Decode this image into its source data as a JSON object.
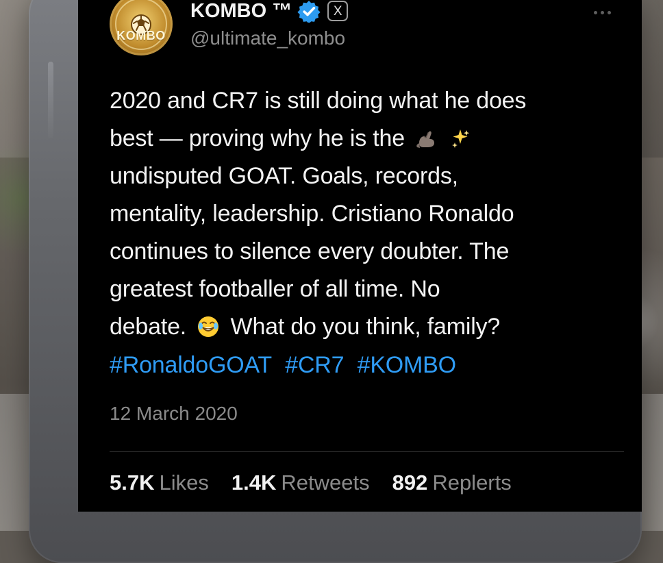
{
  "profile": {
    "display_name": "KOMBO ™",
    "handle": "@ultimate_kombo",
    "avatar_text": "KOMBO"
  },
  "icons": {
    "verified": "verified-badge-icon",
    "platform": "x-logo-icon",
    "more": "more-options-icon",
    "flex": "flexed-biceps-icon",
    "sparkles": "sparkles-icon",
    "laugh": "laughing-face-icon"
  },
  "platform_badge_label": "X",
  "tweet": {
    "lines": [
      "2020 and CR7 is still doing what he does",
      "best — proving why he is the",
      "undisputed GOAT. Goals, records,",
      "mentality, leadership. Cristiano Ronaldo",
      "continues to silence every doubter. The",
      "greatest footballer of all time. No",
      "debate.",
      "What do you think, family?"
    ],
    "hashtags": [
      "#RonaldoGOAT",
      "#CR7",
      "#KOMBO"
    ]
  },
  "timestamp": "12 March 2020",
  "stats": [
    {
      "value": "5.7K",
      "label": "Likes"
    },
    {
      "value": "1.4K",
      "label": "Retweets"
    },
    {
      "value": "892",
      "label": "Replerts"
    }
  ],
  "colors": {
    "screen_background": "#000000",
    "text_primary": "#f3f3f3",
    "text_secondary": "#8a8a8a",
    "hashtag_blue": "#2f9cf5",
    "verified_blue": "#2d9bf0"
  }
}
